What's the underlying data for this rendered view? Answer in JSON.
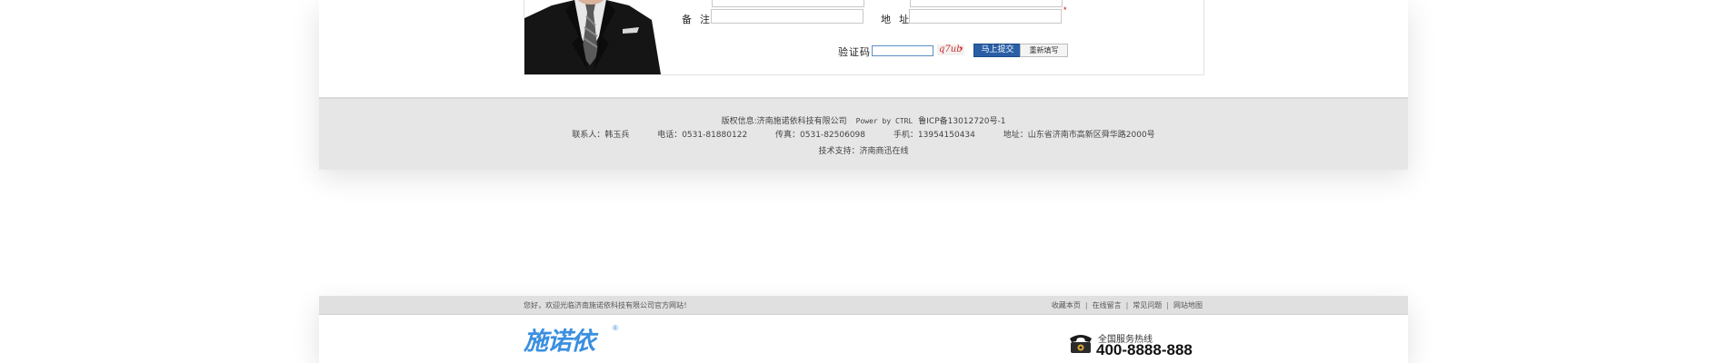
{
  "form": {
    "remark_label": "备  注:",
    "address_label": "地  址:",
    "captcha_label": "验证码:",
    "captcha_value": "",
    "captcha_code": "q7ub",
    "required_mark": "*",
    "submit_label": "马上提交",
    "reset_label": "重新填写"
  },
  "footer": {
    "copyright_label": "版权信息:",
    "company": "济南施诺依科技有限公司",
    "power": "Power by CTRL",
    "icp": "鲁ICP备13012720号-1",
    "contact": "联系人：韩玉兵",
    "phone": "电话：0531-81880122",
    "fax": "传真：0531-82506098",
    "mobile": "手机：13954150434",
    "address": "地址：山东省济南市高新区舜华路2000号",
    "support": "技术支持：济南商迅在线"
  },
  "topbar": {
    "welcome": "您好，欢迎光临济南施诺依科技有限公司官方网站！",
    "links": [
      "收藏本页",
      "在线留言",
      "常见问题",
      "网站地图"
    ],
    "separator": "|"
  },
  "header": {
    "logo_text": "施诺依",
    "logo_mark": "®",
    "hotline_label": "全国服务热线",
    "hotline_number": "400-8888-888"
  },
  "icons": [
    "person-photo",
    "phone-icon"
  ],
  "colors": {
    "footer_bg": "#e6e6e6",
    "topbar_bg": "#e0e0e0",
    "logo": "#3a8fe0",
    "submit_btn": "#2a5fa6",
    "required": "#d40000"
  }
}
